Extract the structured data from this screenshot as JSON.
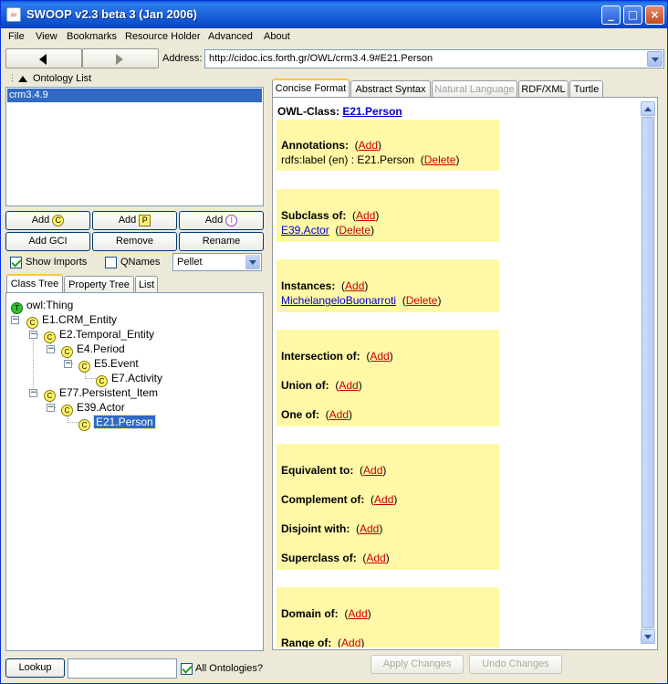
{
  "window": {
    "title": "SWOOP v2.3 beta 3 (Jan 2006)"
  },
  "menu": [
    "File",
    "View",
    "Bookmarks",
    "Resource Holder",
    "Advanced",
    "About"
  ],
  "address": {
    "label": "Address:",
    "value": "http://cidoc.ics.forth.gr/OWL/crm3.4.9#E21.Person"
  },
  "ontology_list": {
    "header": "Ontology List",
    "items": [
      "crm3.4.9"
    ]
  },
  "buttons": {
    "add_class": "Add",
    "add_class_badge": "C",
    "add_property": "Add",
    "add_property_badge": "P",
    "add_individual": "Add",
    "add_individual_badge": "I",
    "add_gci": "Add GCI",
    "remove": "Remove",
    "rename": "Rename",
    "lookup": "Lookup",
    "apply": "Apply Changes",
    "undo": "Undo Changes"
  },
  "options": {
    "show_imports": "Show Imports",
    "qnames": "QNames",
    "reasoner": "Pellet",
    "all_ontologies": "All Ontologies?"
  },
  "left_tabs": [
    "Class Tree",
    "Property Tree",
    "List"
  ],
  "tree": {
    "root": "owl:Thing",
    "root_badge": "T",
    "class_badge": "C",
    "nodes": [
      "E1.CRM_Entity",
      "E2.Temporal_Entity",
      "E4.Period",
      "E5.Event",
      "E7.Activity",
      "E77.Persistent_Item",
      "E39.Actor",
      "E21.Person"
    ]
  },
  "right_tabs": [
    "Concise Format",
    "Abstract Syntax",
    "Natural Language",
    "RDF/XML",
    "Turtle"
  ],
  "details": {
    "class_label": "OWL-Class:",
    "class_name": "E21.Person",
    "add": "(Add)",
    "delete": "(Delete)",
    "open_paren": "(",
    "close_paren": ")",
    "add_word": "Add",
    "delete_word": "Delete",
    "annotations": "Annotations:",
    "annotation_value": "rdfs:label (en) : E21.Person",
    "subclass_of": "Subclass of:",
    "subclass_value": "E39.Actor",
    "instances": "Instances:",
    "instance_value": "MichelangeloBuonarroti",
    "intersection_of": "Intersection of:",
    "union_of": "Union of:",
    "one_of": "One of:",
    "equivalent_to": "Equivalent to:",
    "complement_of": "Complement of:",
    "disjoint_with": "Disjoint with:",
    "superclass_of": "Superclass of:",
    "domain_of": "Domain of:",
    "range_of": "Range of:"
  },
  "colors": {
    "titlebar": "#0A4BC9",
    "selection": "#316AC5",
    "section_bg": "#FFF8A6",
    "link": "#0000CC",
    "action_link": "#CC0000"
  }
}
